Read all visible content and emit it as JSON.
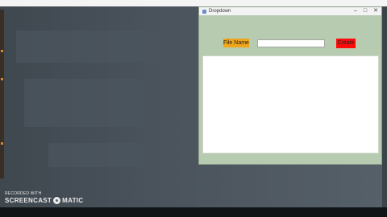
{
  "window": {
    "title": "Dropdown",
    "controls": {
      "minimize": "–",
      "maximize": "□",
      "close": "✕"
    }
  },
  "form": {
    "file_name_label": "File Name",
    "file_name_value": "",
    "create_label": "Create"
  },
  "watermark": {
    "line1": "RECORDED WITH",
    "brand_left": "SCREENCAST",
    "brand_right": "MATIC"
  },
  "colors": {
    "window_bg": "#b7cbb0",
    "label_bg": "#f0a51a",
    "create_bg": "#ff0a0a"
  }
}
